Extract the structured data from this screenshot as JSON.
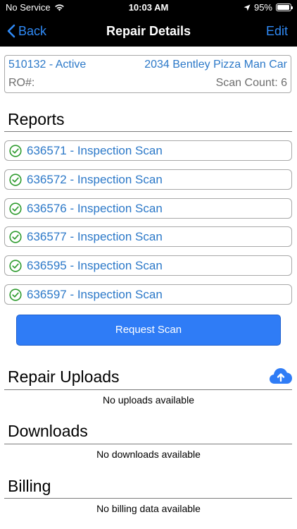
{
  "status_bar": {
    "carrier": "No Service",
    "time": "10:03 AM",
    "battery": "95%",
    "battery_level": 0.95,
    "icons": [
      "wifi-icon",
      "location-arrow-icon",
      "battery-icon"
    ]
  },
  "nav": {
    "back_label": "Back",
    "title": "Repair Details",
    "edit_label": "Edit"
  },
  "repair": {
    "id_status": "510132 - Active",
    "vehicle": "2034 Bentley Pizza Man Car",
    "ro_label": "RO#:",
    "scan_count": "Scan Count: 6"
  },
  "reports": {
    "title": "Reports",
    "items": [
      {
        "label": "636571 - Inspection Scan"
      },
      {
        "label": "636572 - Inspection Scan"
      },
      {
        "label": "636576 - Inspection Scan"
      },
      {
        "label": "636577 - Inspection Scan"
      },
      {
        "label": "636595 - Inspection Scan"
      },
      {
        "label": "636597 - Inspection Scan"
      }
    ]
  },
  "request_scan_label": "Request Scan",
  "uploads": {
    "title": "Repair Uploads",
    "empty": "No uploads available"
  },
  "downloads": {
    "title": "Downloads",
    "empty": "No downloads available"
  },
  "billing": {
    "title": "Billing",
    "empty": "No billing data available"
  },
  "colors": {
    "accent": "#2f8af6",
    "link": "#2b78c8",
    "check": "#2e9b2e",
    "button": "#2f7cf6"
  }
}
